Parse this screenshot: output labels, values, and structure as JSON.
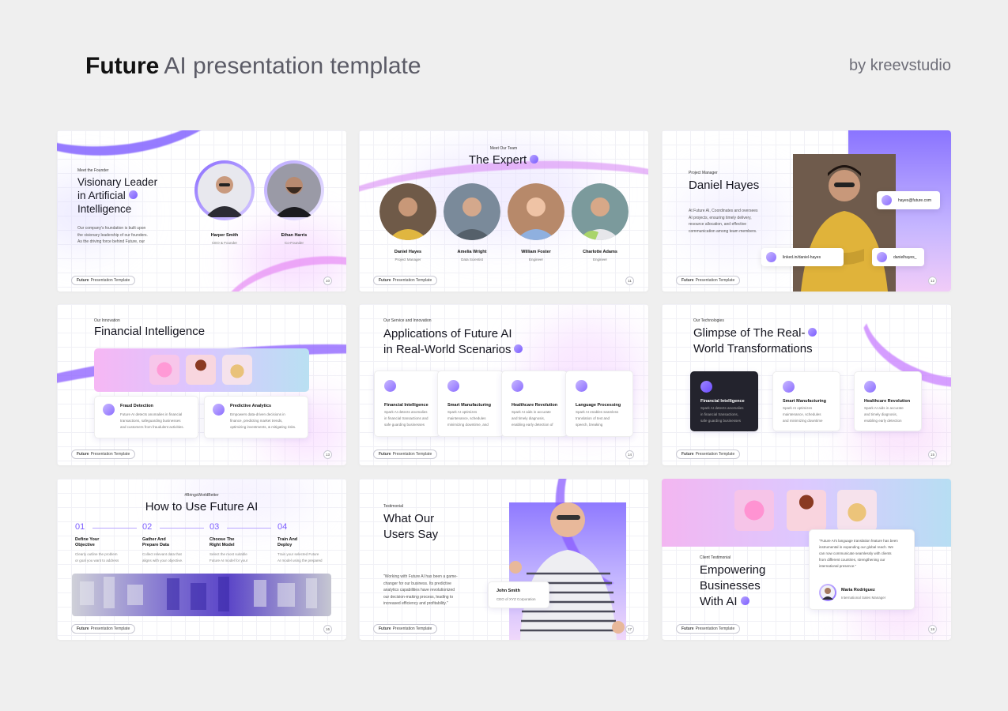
{
  "header": {
    "title_bold": "Future",
    "title_rest": "AI presentation template",
    "byline": "by kreevstudio"
  },
  "footer": {
    "brand": "Future",
    "label": "Presentation Template"
  },
  "slides": [
    {
      "page": "10",
      "eyebrow": "Meet the Founder",
      "title_lines": [
        "Visionary Leader",
        "in Artificial",
        "Intelligence"
      ],
      "body": [
        "Our company's foundation is built upon",
        "the visionary leadership of our founders.",
        "As the driving force behind Future, our"
      ],
      "people": [
        {
          "name": "Harper Smith",
          "role": "CEO & Founder"
        },
        {
          "name": "Ethan Harris",
          "role": "Co-Founder"
        }
      ]
    },
    {
      "page": "11",
      "eyebrow": "Meet Our Team",
      "title": "The Expert",
      "people": [
        {
          "name": "Daniel Hayes",
          "role": "Project Manager"
        },
        {
          "name": "Amelia Wright",
          "role": "Data Scientist"
        },
        {
          "name": "William Foster",
          "role": "Engineer"
        },
        {
          "name": "Charlotte Adams",
          "role": "Engineer"
        }
      ]
    },
    {
      "page": "12",
      "eyebrow": "Project Manager",
      "title": "Daniel Hayes",
      "body": [
        "At Future AI, Coordinates and oversees",
        "AI projects, ensuring timely delivery,",
        "resource allocation, and effective",
        "communication among team members."
      ],
      "email": "hayes@future.com",
      "linkedin": "linked.in/daniel-hayes",
      "instagram": "danielhayes_"
    },
    {
      "page": "13",
      "eyebrow": "Our Innovation",
      "title": "Financial Intelligence",
      "cards": [
        {
          "title": "Fraud Detection",
          "body": [
            "Future AI detects anomalies in financial",
            "transactions, safeguarding businesses",
            "and customers from fraudulent activities."
          ]
        },
        {
          "title": "Predictive Analytics",
          "body": [
            "Empowers data-driven decisions in",
            "finance, predicting market trends,",
            "optimizing investments, & mitigating risks."
          ]
        }
      ]
    },
    {
      "page": "14",
      "eyebrow": "Our Service and Innovation",
      "title_lines": [
        "Applications of Future AI",
        "in Real-World Scenarios"
      ],
      "cards": [
        {
          "title": "Financial Intelligence",
          "body": [
            "Spark AI detects anomalies",
            "in financial transactions and",
            "safe guarding businesses"
          ]
        },
        {
          "title": "Smart Manufacturing",
          "body": [
            "Spark AI optimizes",
            "maintenance, schedules",
            "minimizing downtime, and"
          ]
        },
        {
          "title": "Healthcare Revolution",
          "body": [
            "Spark AI aids in accurate",
            "and timely diagnosis,",
            "enabling early detection of"
          ]
        },
        {
          "title": "Language Processing",
          "body": [
            "Spark AI enables seamless",
            "translation of text and",
            "speech, breaking"
          ]
        }
      ]
    },
    {
      "page": "15",
      "eyebrow": "Our Technologies",
      "title_lines": [
        "Glimpse of The Real-",
        "World Transformations"
      ],
      "cards": [
        {
          "title": "Financial Intelligence",
          "body": [
            "Spark AI detects anomalies",
            "in financial transactions,",
            "safe guarding businesses"
          ]
        },
        {
          "title": "Smart Manufacturing",
          "body": [
            "Spark AI optimizes",
            "maintenance, schedules",
            "and minimizing downtime"
          ]
        },
        {
          "title": "Healthcare Revolution",
          "body": [
            "Spark AI aids in accurate",
            "and timely diagnosis,",
            "enabling early detection"
          ]
        }
      ]
    },
    {
      "page": "16",
      "eyebrow": "#BringsWorldBetter",
      "title": "How to Use Future AI",
      "steps": [
        {
          "num": "01",
          "title": [
            "Define Your",
            "Objective"
          ],
          "body": [
            "Clearly outline the problem",
            "or goal you want to address"
          ]
        },
        {
          "num": "02",
          "title": [
            "Gather And",
            "Prepare Data"
          ],
          "body": [
            "Collect relevant data that",
            "aligns with your objective."
          ]
        },
        {
          "num": "03",
          "title": [
            "Choose The",
            "Right Model"
          ],
          "body": [
            "Select the most suitable",
            "Future AI model for your"
          ]
        },
        {
          "num": "04",
          "title": [
            "Train And",
            "Deploy"
          ],
          "body": [
            "Train your selected Future",
            "AI model using the prepared"
          ]
        }
      ]
    },
    {
      "page": "17",
      "eyebrow": "Testimonial",
      "title_lines": [
        "What Our",
        "Users Say"
      ],
      "quote": [
        "\"Working with Future AI has been a game-",
        "changer for our business. Its predictive",
        "analytics capabilities have revolutionized",
        "our decision-making process, leading to",
        "increased efficiency and profitability.\""
      ],
      "person": {
        "name": "John Smith",
        "role": "CEO of XYZ Corporation"
      }
    },
    {
      "page": "18",
      "eyebrow": "Client Testimonial",
      "title_lines": [
        "Empowering",
        "Businesses",
        "With AI"
      ],
      "quote": [
        "\"Future AI's language translation feature has been",
        "instrumental in expanding our global reach. We",
        "can now communicate seamlessly with clients",
        "from different countries, strengthening our",
        "international presence.\""
      ],
      "person": {
        "name": "Maria Rodriguez",
        "role": "International Sales Manager"
      }
    }
  ]
}
